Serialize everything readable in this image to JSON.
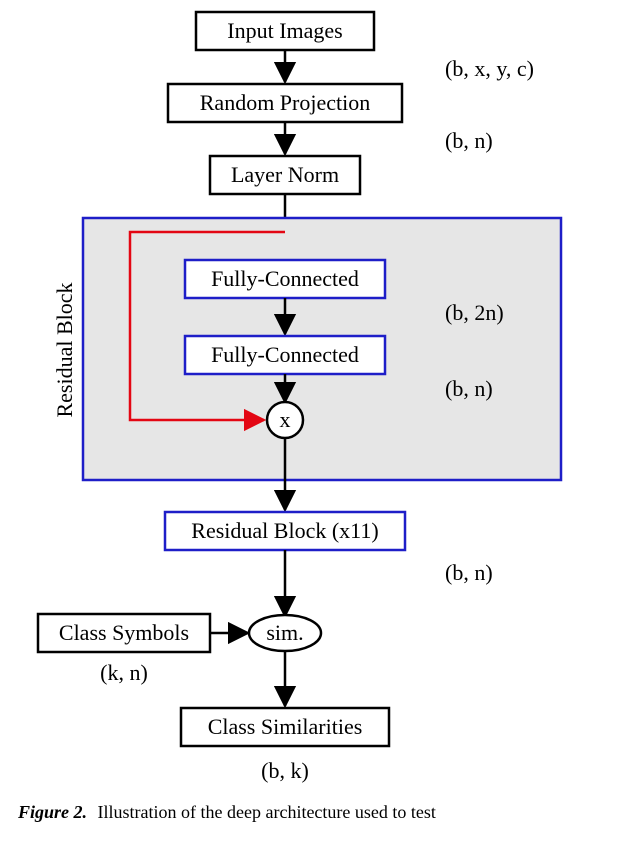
{
  "nodes": {
    "input": "Input Images",
    "randproj": "Random Projection",
    "layernorm": "Layer Norm",
    "fc1": "Fully-Connected",
    "fc2": "Fully-Connected",
    "residual_repeat": "Residual Block (x11)",
    "class_symbols": "Class Symbols",
    "sim": "sim.",
    "class_sim": "Class Similarities",
    "mult": "x"
  },
  "dims": {
    "after_input": "(b, x, y, c)",
    "after_randproj": "(b, n)",
    "after_fc1": "(b, 2n)",
    "after_fc2": "(b, n)",
    "after_residual_repeat": "(b, n)",
    "class_symbols": "(k, n)",
    "output": "(b, k)"
  },
  "sidebar": "Residual Block",
  "caption_prefix": "Figure 2.",
  "caption_rest": "Illustration of the deep architecture used to test"
}
